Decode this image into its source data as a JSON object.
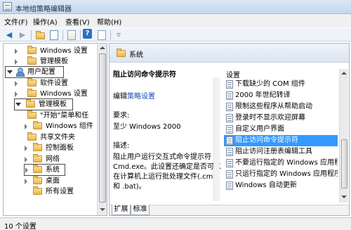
{
  "window": {
    "title": "本地组策略编辑器"
  },
  "menu": {
    "items": [
      "文件(F)",
      "操作(A)",
      "查看(V)",
      "帮助(H)"
    ]
  },
  "toolbar": {
    "buttons": [
      "back-arrow-icon",
      "forward-arrow-icon",
      "up-folder-icon",
      "show-hide-tree-icon",
      "export-list-icon",
      "help-icon",
      "properties-icon",
      "filter-icon"
    ],
    "help_glyph": "?"
  },
  "tree": {
    "items": [
      {
        "label": "Windows 设置"
      },
      {
        "label": "管理模板"
      },
      {
        "label": "用户配置"
      },
      {
        "label": "软件设置"
      },
      {
        "label": "Windows 设置"
      },
      {
        "label": "管理模板"
      },
      {
        "label": "\"开始\"菜单和任"
      },
      {
        "label": "Windows 组件"
      },
      {
        "label": "共享文件夹"
      },
      {
        "label": "控制面板"
      },
      {
        "label": "网络"
      },
      {
        "label": "系统"
      },
      {
        "label": "桌面"
      },
      {
        "label": "所有设置"
      }
    ]
  },
  "right": {
    "header": "系统",
    "description": {
      "title": "阻止访问命令提示符",
      "edit_prefix": "编辑",
      "edit_link": "策略设置",
      "requirements_label": "要求:",
      "requirements_value": "至少 Windows 2000",
      "desc_label": "描述:",
      "lines": [
        "阻止用户运行交互式命令提示符",
        "Cmd.exe。此设置还确定是否可以",
        "在计算机上运行批处理文件(.cmd",
        "和 .bat)。"
      ]
    },
    "settings_header": "设置",
    "settings": [
      "下载缺少的 COM 组件",
      "2000 年世纪转译",
      "限制这些程序从帮助启动",
      "登录时不显示欢迎屏幕",
      "自定义用户界面",
      "阻止访问命令提示符",
      "阻止访问注册表编辑工具",
      "不要运行指定的 Windows 应用程序",
      "只运行指定的 Windows 应用程序",
      "Windows 自动更新"
    ],
    "selected_setting": "阻止访问命令提示符",
    "tabs": [
      "扩展",
      "标准"
    ]
  },
  "status": {
    "text": "10 个设置"
  }
}
